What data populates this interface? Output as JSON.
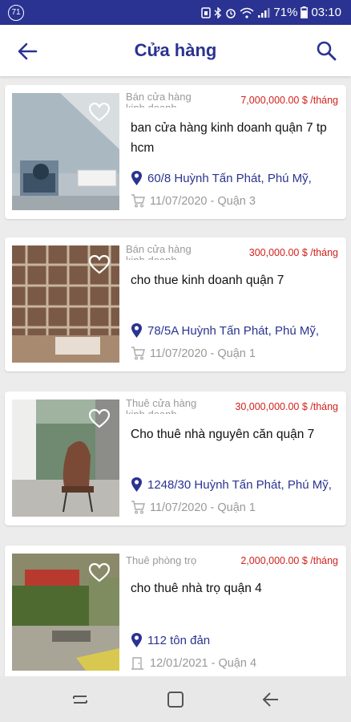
{
  "status_bar": {
    "notification_count": "71",
    "battery": "71%",
    "time": "03:10"
  },
  "header": {
    "title": "Cửa hàng"
  },
  "listings": [
    {
      "category": "Bán cửa hàng kinh doanh",
      "price": "7,000,000.00 $ /tháng",
      "title": "ban cửa hàng kinh doanh quận 7 tp hcm",
      "address": "60/8 Huỳnh Tấn Phát, Phú Mỹ,",
      "meta": "11/07/2020 - Quận 3"
    },
    {
      "category": "Bán cửa hàng kinh doanh",
      "price": "300,000.00 $ /tháng",
      "title": "cho thue kinh doanh quận 7",
      "address": "78/5A Huỳnh Tấn Phát, Phú Mỹ,",
      "meta": "11/07/2020 - Quận 1"
    },
    {
      "category": "Thuê cửa hàng kinh doanh",
      "price": "30,000,000.00 $ /tháng",
      "title": "Cho thuê nhà nguyên căn quận 7",
      "address": "1248/30 Huỳnh Tấn Phát, Phú Mỹ,",
      "meta": "11/07/2020 - Quận 1"
    },
    {
      "category": "Thuê phòng trọ",
      "price": "2,000,000.00 $ /tháng",
      "title": "cho thuê nhà trọ quận 4",
      "address": "112 tôn đản",
      "meta": "12/01/2021 - Quận 4"
    }
  ],
  "colors": {
    "primary": "#2a3391",
    "price": "#d0211c",
    "muted": "#9a9a9a"
  },
  "icons": {
    "back": "arrow-left-icon",
    "search": "search-icon",
    "favorite": "heart-outline-icon",
    "location": "map-pin-icon",
    "cart": "cart-icon"
  }
}
